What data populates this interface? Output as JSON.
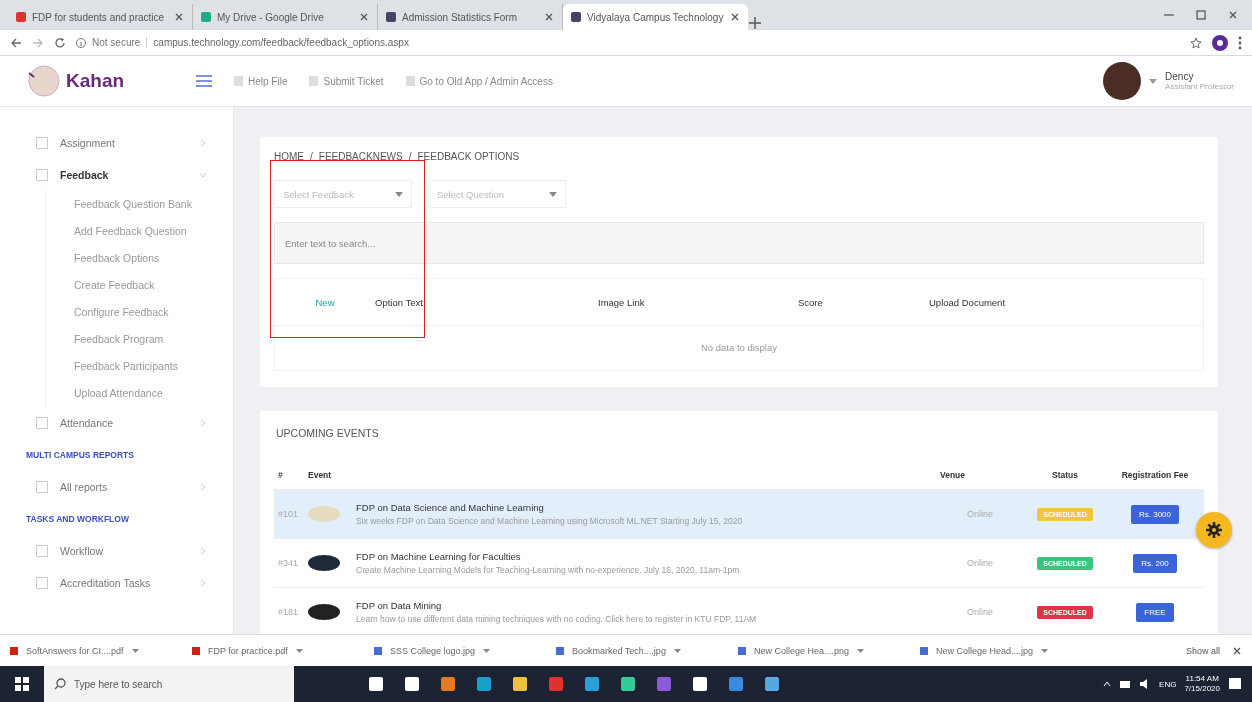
{
  "browser": {
    "tabs": [
      {
        "title": "FDP for students and practice",
        "selected": false
      },
      {
        "title": "My Drive - Google Drive",
        "selected": false
      },
      {
        "title": "Admission Statistics Form",
        "selected": false
      },
      {
        "title": "Vidyalaya Campus Technology",
        "selected": true
      }
    ],
    "address": {
      "security": "Not secure",
      "url": "campus.technology.com/feedback/feedback_options.aspx"
    }
  },
  "header": {
    "logo": "Kahan",
    "links": [
      "Help File",
      "Submit Ticket",
      "Go to Old App / Admin Access"
    ],
    "user": {
      "name": "Dency",
      "role": "Assistant Professor"
    }
  },
  "sidebar": {
    "items": [
      {
        "kind": "item",
        "label": "Assignment",
        "expanded": false
      },
      {
        "kind": "item",
        "label": "Feedback",
        "expanded": true,
        "children": [
          {
            "label": "Feedback Question Bank"
          },
          {
            "label": "Add Feedback Question"
          },
          {
            "label": "Feedback Options"
          },
          {
            "label": "Create Feedback"
          },
          {
            "label": "Configure Feedback"
          },
          {
            "label": "Feedback Program"
          },
          {
            "label": "Feedback Participants"
          },
          {
            "label": "Upload Attendance"
          }
        ]
      },
      {
        "kind": "item",
        "label": "Attendance",
        "expanded": false
      },
      {
        "kind": "section",
        "label": "MULTI CAMPUS REPORTS"
      },
      {
        "kind": "item",
        "label": "All reports",
        "expanded": false
      },
      {
        "kind": "section",
        "label": "TASKS AND WORKFLOW"
      },
      {
        "kind": "item",
        "label": "Workflow",
        "expanded": false
      },
      {
        "kind": "item",
        "label": "Accreditation Tasks",
        "expanded": false
      }
    ]
  },
  "breadcrumb": [
    "HOME",
    "FEEDBACKNEWS",
    "FEEDBACK OPTIONS"
  ],
  "breadcrumb_separator": "/",
  "filters": [
    {
      "placeholder": "Select Feedback"
    },
    {
      "placeholder": "Select Question"
    }
  ],
  "search": {
    "placeholder": "Enter text to search..."
  },
  "table": {
    "new_link": "New",
    "columns": [
      "Option Text",
      "Image Link",
      "Score",
      "Upload Document"
    ],
    "empty_text": "No data to display"
  },
  "events": {
    "title": "UPCOMING EVENTS",
    "columns": [
      "#",
      "Event",
      "Venue",
      "Status",
      "Registration Fee"
    ],
    "rows": [
      {
        "id": "#101",
        "title": "FDP on Data Science and Machine Learning",
        "description": "Six weeks FDP on Data Science and Machine Learning using Microsoft ML.NET Starting July 15, 2020",
        "venue": "Online",
        "status": "SCHEDULED",
        "color": "#f5c342",
        "fee": "Rs. 3000",
        "selected": true
      },
      {
        "id": "#341",
        "title": "FDP on Machine Learning for Faculties",
        "description": "Create Machine Learning Models for Teaching-Learning with no-experience. July 16, 2020, 11am-1pm",
        "venue": "Online",
        "status": "SCHEDULED",
        "color": "#3cc47c",
        "fee": "Rs. 200",
        "selected": false
      },
      {
        "id": "#181",
        "title": "FDP on Data Mining",
        "description": "Learn how to use different data mining techniques with no coding. Click here to register in KTU FDP, 11AM",
        "venue": "Online",
        "status": "SCHEDULED",
        "color": "#dc3545",
        "fee": "FREE",
        "selected": false
      }
    ]
  },
  "downloads": {
    "files": [
      "SoftAnswers for CI....pdf",
      "FDP for practice.pdf",
      "SSS College logo.jpg",
      "Bookmarked Tech....jpg",
      "New College Hea....png",
      "New College Head....jpg"
    ],
    "show_all": "Show all"
  },
  "taskbar": {
    "search_placeholder": "Type here to search",
    "language": "ENG",
    "time": "11:54 AM",
    "date": "7/15/2020"
  }
}
